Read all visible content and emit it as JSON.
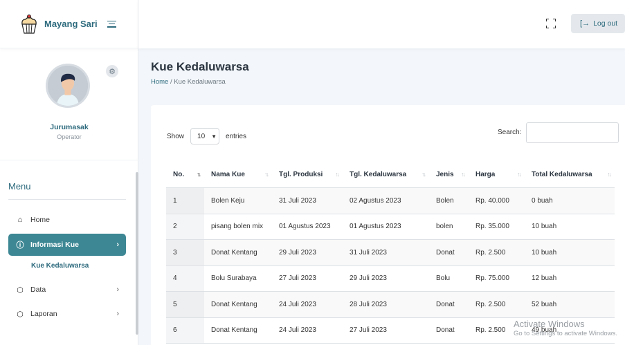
{
  "brand": {
    "name": "Mayang Sari"
  },
  "profile": {
    "name": "Jurumasak",
    "role": "Operator"
  },
  "menu": {
    "title": "Menu",
    "items": [
      {
        "label": "Home",
        "icon": "home-icon"
      },
      {
        "label": "Informasi Kue",
        "icon": "info-icon",
        "chevron": "›"
      },
      {
        "label": "Data",
        "icon": "cube-icon",
        "chevron": "›"
      },
      {
        "label": "Laporan",
        "icon": "cube-icon",
        "chevron": "›"
      }
    ],
    "subitem": "Kue Kedaluwarsa"
  },
  "topbar": {
    "logout_label": "Log out"
  },
  "page": {
    "title": "Kue Kedaluwarsa",
    "breadcrumb": {
      "home": "Home",
      "separator": "/",
      "current": "Kue Kedaluwarsa"
    }
  },
  "table_controls": {
    "show_label": "Show",
    "entries_value": "10",
    "entries_label": "entries",
    "search_label": "Search:"
  },
  "table": {
    "headers": [
      "No.",
      "Nama Kue",
      "Tgl. Produksi",
      "Tgl. Kedaluwarsa",
      "Jenis",
      "Harga",
      "Total Kedaluwarsa"
    ],
    "rows": [
      [
        "1",
        "Bolen Keju",
        "31 Juli 2023",
        "02 Agustus 2023",
        "Bolen",
        "Rp. 40.000",
        "0 buah"
      ],
      [
        "2",
        "pisang bolen mix",
        "01 Agustus 2023",
        "01 Agustus 2023",
        "bolen",
        "Rp. 35.000",
        "10 buah"
      ],
      [
        "3",
        "Donat Kentang",
        "29 Juli 2023",
        "31 Juli 2023",
        "Donat",
        "Rp. 2.500",
        "10 buah"
      ],
      [
        "4",
        "Bolu Surabaya",
        "27 Juli 2023",
        "29 Juli 2023",
        "Bolu",
        "Rp. 75.000",
        "12 buah"
      ],
      [
        "5",
        "Donat Kentang",
        "24 Juli 2023",
        "28 Juli 2023",
        "Donat",
        "Rp. 2.500",
        "52 buah"
      ],
      [
        "6",
        "Donat Kentang",
        "24 Juli 2023",
        "27 Juli 2023",
        "Donat",
        "Rp. 2.500",
        "49 buah"
      ]
    ]
  },
  "watermark": {
    "line1": "Activate Windows",
    "line2": "Go to Settings to activate Windows."
  },
  "colors": {
    "accent": "#3d8794",
    "brand_text": "#2d6a7d",
    "background": "#f3f7fb"
  }
}
